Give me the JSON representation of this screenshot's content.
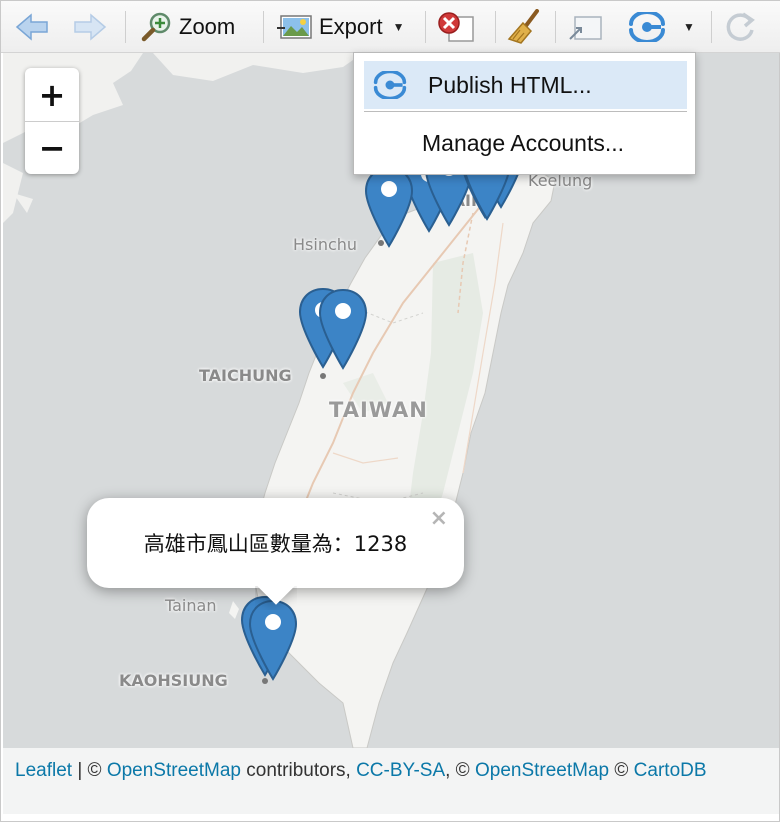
{
  "toolbar": {
    "zoom_label": "Zoom",
    "export_label": "Export"
  },
  "publish_menu": {
    "items": [
      {
        "label": "Publish HTML..."
      },
      {
        "label": "Manage Accounts..."
      }
    ]
  },
  "map": {
    "zoom_in_label": "+",
    "zoom_out_label": "−",
    "places": {
      "keelung": "Keelung",
      "taipei_partial": "TAIPE",
      "hsinchu": "Hsinchu",
      "taichung": "TAICHUNG",
      "taiwan": "TAIWAN",
      "tainan": "Tainan",
      "kaohsiung": "KAOHSIUNG"
    },
    "marker_color": "#3c84c6",
    "popup": {
      "text": "高雄市鳳山區數量為：1238",
      "close_label": "×"
    }
  },
  "attribution": {
    "leaflet": "Leaflet",
    "sep1": " | © ",
    "osm1": "OpenStreetMap",
    "contributors": " contributors, ",
    "ccbysa": "CC-BY-SA",
    "sep2": ", © ",
    "osm2": "OpenStreetMap",
    "sep3": " © ",
    "cartodb": "CartoDB"
  }
}
